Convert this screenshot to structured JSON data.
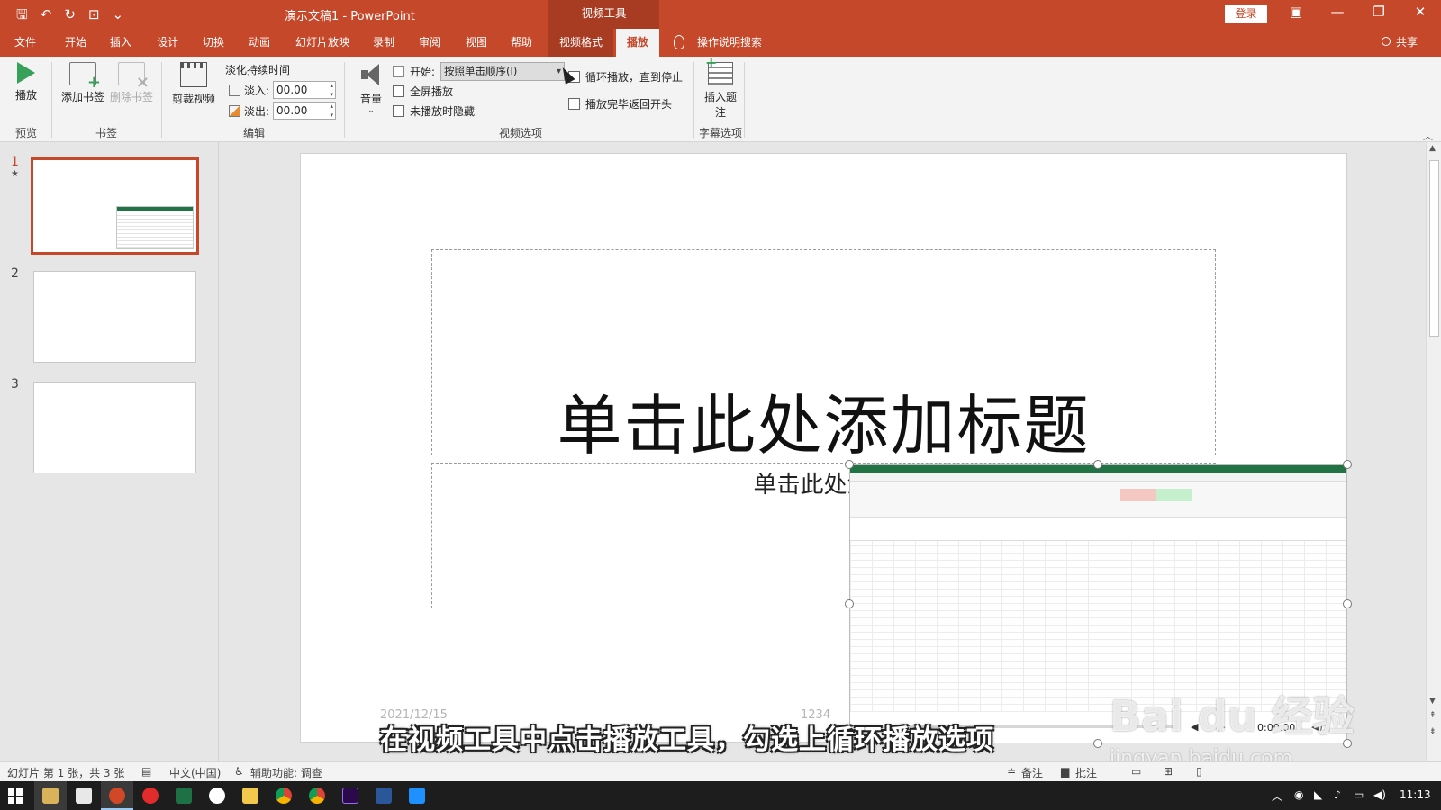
{
  "titlebar": {
    "doc_title": "演示文稿1  -  PowerPoint",
    "context_tab_group": "视频工具",
    "login": "登录"
  },
  "menu": {
    "tabs": [
      "文件",
      "开始",
      "插入",
      "设计",
      "切换",
      "动画",
      "幻灯片放映",
      "录制",
      "审阅",
      "视图",
      "帮助"
    ],
    "context_tab": "视频格式",
    "active_tab": "播放",
    "search": "操作说明搜索",
    "share": "共享"
  },
  "ribbon": {
    "preview": {
      "play": "播放",
      "group": "预览"
    },
    "bookmarks": {
      "add": "添加书签",
      "remove": "删除书签",
      "group": "书签"
    },
    "editing": {
      "trim": "剪裁视频",
      "fade_title": "淡化持续时间",
      "fade_in_label": "淡入:",
      "fade_in_value": "00.00",
      "fade_out_label": "淡出:",
      "fade_out_value": "00.00",
      "group": "编辑"
    },
    "video_options": {
      "volume": "音量",
      "start_label": "开始:",
      "start_value": "按照单击顺序(I)",
      "fullscreen": "全屏播放",
      "hide_not_playing": "未播放时隐藏",
      "loop": "循环播放，直到停止",
      "rewind": "播放完毕返回开头",
      "group": "视频选项"
    },
    "captions": {
      "insert_line1": "插入题",
      "insert_line2": "注",
      "group": "字幕选项"
    }
  },
  "thumbnails": [
    {
      "number": "1",
      "star": "★"
    },
    {
      "number": "2"
    },
    {
      "number": "3"
    }
  ],
  "slide": {
    "title_placeholder": "单击此处添加标题",
    "subtitle_placeholder": "单击此处添加",
    "footer_date": "2021/12/15",
    "footer_number": "1234"
  },
  "video": {
    "time": "0:00.00"
  },
  "overlay": {
    "subtitle": "在视频工具中点击播放工具，勾选上循环播放选项",
    "watermark": "Bai du 经验",
    "watermark_url": "jingyan.baidu.com"
  },
  "statusbar": {
    "slide_info": "幻灯片 第 1 张，共 3 张",
    "language": "中文(中国)",
    "accessibility": "辅助功能: 调查",
    "notes": "备注",
    "comments": "批注"
  },
  "taskbar": {
    "time": "11:13"
  }
}
